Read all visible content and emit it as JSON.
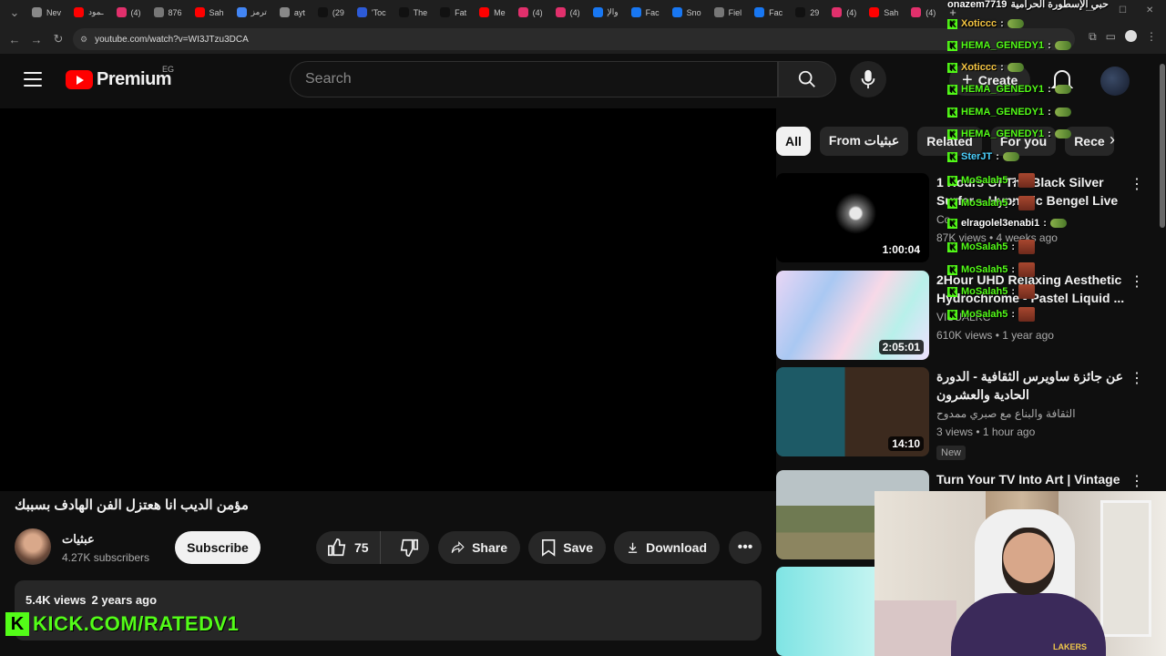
{
  "browser": {
    "tabs": [
      {
        "label": "Nev",
        "color": "#888888"
      },
      {
        "label": "ـمود",
        "color": "#ff0000"
      },
      {
        "label": "(4)",
        "color": "#e1306c"
      },
      {
        "label": "876",
        "color": "#777777"
      },
      {
        "label": "Sah",
        "color": "#ff0000"
      },
      {
        "label": "ترمز",
        "color": "#4285f4"
      },
      {
        "label": "ayt",
        "color": "#888888"
      },
      {
        "label": "(29",
        "color": "#111111"
      },
      {
        "label": "'Toc",
        "color": "#2d5bd8"
      },
      {
        "label": "The",
        "color": "#111111"
      },
      {
        "label": "Fat",
        "color": "#111111"
      },
      {
        "label": "Me",
        "color": "#ff0000"
      },
      {
        "label": "(4)",
        "color": "#e1306c"
      },
      {
        "label": "(4)",
        "color": "#e1306c"
      },
      {
        "label": "والإ",
        "color": "#1877f2"
      },
      {
        "label": "Fac",
        "color": "#1877f2"
      },
      {
        "label": "Sno",
        "color": "#1877f2"
      },
      {
        "label": "Fiel",
        "color": "#777777"
      },
      {
        "label": "Fac",
        "color": "#1877f2"
      },
      {
        "label": "29",
        "color": "#111111"
      },
      {
        "label": "(4)",
        "color": "#e1306c"
      },
      {
        "label": "Sah",
        "color": "#ff0000"
      },
      {
        "label": "(4)",
        "color": "#e1306c"
      }
    ],
    "url": "youtube.com/watch?v=WI3JTzu3DCA"
  },
  "header": {
    "logo_text": "Premium",
    "country_code": "EG",
    "search_placeholder": "Search",
    "create_label": "Create"
  },
  "video": {
    "title": "مؤمن الديب انا هعتزل الفن الهادف بسببك",
    "channel_name": "عبثيات",
    "subscribers": "4.27K subscribers",
    "subscribe_label": "Subscribe",
    "likes": "75",
    "share_label": "Share",
    "save_label": "Save",
    "download_label": "Download",
    "views": "5.4K views",
    "age": "2 years ago"
  },
  "chips": [
    "All",
    "From عبثيات",
    "Related",
    "For you",
    "Rece"
  ],
  "recommendations": [
    {
      "title": "1 Hours Of The Black Silver Surfer – Hypnotic Bengel Live ...",
      "channel": "Co",
      "meta": "87K views • 4 weeks ago",
      "duration": "1:00:04",
      "badge": "",
      "thumb": "dark"
    },
    {
      "title": "2Hour UHD Relaxing Aesthetic Hydrochrome - Pastel Liquid ...",
      "channel": "VISUALKC",
      "meta": "610K views • 1 year ago",
      "duration": "2:05:01",
      "badge": "",
      "thumb": "holo"
    },
    {
      "title": "عن جائزة ساويرس الثقافية - الدورة الحادية والعشرون",
      "channel": "الثقافة والبناع مع صبري ممدوح",
      "meta": "3 views • 1 hour ago",
      "duration": "14:10",
      "badge": "New",
      "thumb": "award"
    },
    {
      "title": "Turn Your TV Into Art | Vintage",
      "channel": "",
      "meta": "",
      "duration": "",
      "badge": "",
      "thumb": "landscape"
    },
    {
      "title": "",
      "channel": "",
      "meta": "",
      "duration": "",
      "badge": "",
      "thumb": "cyan"
    }
  ],
  "chat": [
    {
      "user": "onazem7719",
      "text": "حبي الإسطورة الحرامية",
      "color": "#ffffff",
      "emote": ""
    },
    {
      "user": "Xoticcc",
      "text": ":",
      "color": "#f5c542",
      "emote": "green"
    },
    {
      "user": "HEMA_GENEDY1",
      "text": ":",
      "color": "#53fc18",
      "emote": "green"
    },
    {
      "user": "Xoticcc",
      "text": ":",
      "color": "#f5c542",
      "emote": "green"
    },
    {
      "user": "HEMA_GENEDY1",
      "text": ":",
      "color": "#53fc18",
      "emote": "green"
    },
    {
      "user": "HEMA_GENEDY1",
      "text": ":",
      "color": "#53fc18",
      "emote": "green"
    },
    {
      "user": "HEMA_GENEDY1",
      "text": ":",
      "color": "#53fc18",
      "emote": "green"
    },
    {
      "user": "SterJT",
      "text": ":",
      "color": "#4dd2ff",
      "emote": "green"
    },
    {
      "user": "MoSalah5",
      "text": ":",
      "color": "#53fc18",
      "emote": "red"
    },
    {
      "user": "MoSalah5",
      "text": ":",
      "color": "#53fc18",
      "emote": "red"
    },
    {
      "user": "elragolel3enabi1",
      "text": ":",
      "color": "#ffffff",
      "emote": "green"
    },
    {
      "user": "MoSalah5",
      "text": ":",
      "color": "#53fc18",
      "emote": "red"
    },
    {
      "user": "MoSalah5",
      "text": ":",
      "color": "#53fc18",
      "emote": "red"
    },
    {
      "user": "MoSalah5",
      "text": ":",
      "color": "#53fc18",
      "emote": "red"
    },
    {
      "user": "MoSalah5",
      "text": ":",
      "color": "#53fc18",
      "emote": "red"
    }
  ],
  "overlay": {
    "kick_url": "KICK.COM/RATEDV1",
    "jersey_text": "LAKERS"
  },
  "colors": {
    "background": "#0f0f0f",
    "youtube_red": "#ff0000",
    "kick_green": "#53fc18",
    "chip_active": "#f1f1f1"
  }
}
